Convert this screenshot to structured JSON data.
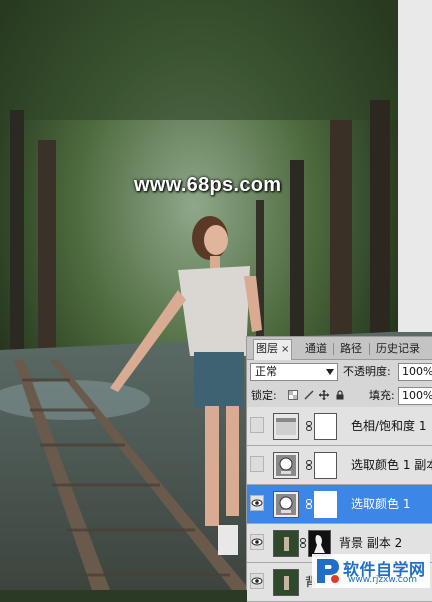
{
  "watermark": {
    "text": "www.68ps.com"
  },
  "layers_panel": {
    "tabs": [
      {
        "label": "图层",
        "close": "×",
        "active": true
      },
      {
        "label": "通道"
      },
      {
        "label": "路径"
      },
      {
        "label": "历史记录"
      }
    ],
    "blend_mode": "正常",
    "opacity_label": "不透明度:",
    "opacity_value": "100%",
    "lock_label": "锁定:",
    "fill_label": "填充:",
    "fill_value": "100%",
    "layers": [
      {
        "name": "色相/饱和度 1",
        "visible": false,
        "type": "adjustment",
        "selected": false
      },
      {
        "name": "选取颜色 1 副本",
        "visible": false,
        "type": "adjustment",
        "selected": false
      },
      {
        "name": "选取颜色 1",
        "visible": true,
        "type": "adjustment",
        "selected": true
      },
      {
        "name": "背景 副本 2",
        "visible": true,
        "type": "pixel-with-mask",
        "selected": false
      },
      {
        "name": "背",
        "visible": true,
        "type": "pixel",
        "selected": false
      }
    ]
  },
  "logo": {
    "name": "软件自学网",
    "url": "www.rjzxw.com"
  }
}
